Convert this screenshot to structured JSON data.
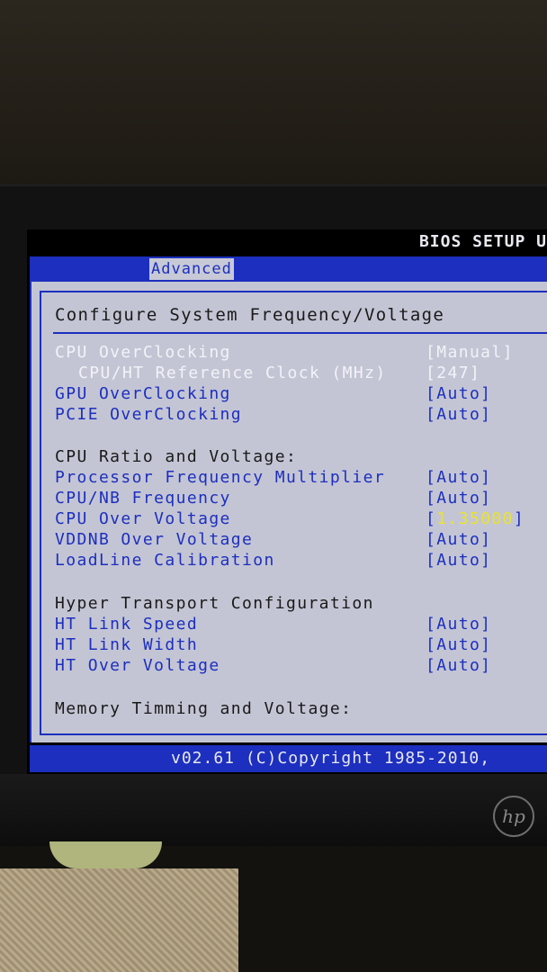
{
  "bios": {
    "title": "BIOS SETUP U",
    "tab": "Advanced",
    "section_heading": "Configure System Frequency/Voltage",
    "items": [
      {
        "label": "CPU OverClocking",
        "value": "[Manual]",
        "style": "sel"
      },
      {
        "label": "CPU/HT Reference Clock (MHz)",
        "value": "[247]",
        "style": "sel-indent"
      },
      {
        "label": "GPU OverClocking",
        "value": "[Auto]",
        "style": "normal"
      },
      {
        "label": "PCIE OverClocking",
        "value": "[Auto]",
        "style": "normal"
      },
      {
        "label": "CPU Ratio and Voltage:",
        "value": "",
        "style": "header"
      },
      {
        "label": "Processor Frequency Multiplier",
        "value": "[Auto]",
        "style": "normal"
      },
      {
        "label": "CPU/NB Frequency",
        "value": "[Auto]",
        "style": "normal"
      },
      {
        "label": "CPU Over Voltage",
        "value_prefix": "[",
        "value_highlight": "1.35000",
        "value_suffix": "]",
        "style": "normal"
      },
      {
        "label": "VDDNB Over Voltage",
        "value": "[Auto]",
        "style": "normal"
      },
      {
        "label": "LoadLine Calibration",
        "value": "[Auto]",
        "style": "normal"
      },
      {
        "label": "Hyper Transport Configuration",
        "value": "",
        "style": "header"
      },
      {
        "label": "HT Link Speed",
        "value": "[Auto]",
        "style": "normal"
      },
      {
        "label": "HT Link Width",
        "value": "[Auto]",
        "style": "normal"
      },
      {
        "label": "HT Over Voltage",
        "value": "[Auto]",
        "style": "normal"
      },
      {
        "label": "Memory Timming and Voltage:",
        "value": "",
        "style": "header"
      }
    ],
    "footer": "v02.61 (C)Copyright 1985-2010,"
  },
  "monitor": {
    "brand_icon": "hp-logo-icon",
    "brand_text": "hp"
  },
  "colors": {
    "bios_blue": "#1c2fbf",
    "panel_gray": "#c4c5d4",
    "highlight_yellow": "#e8e330"
  }
}
